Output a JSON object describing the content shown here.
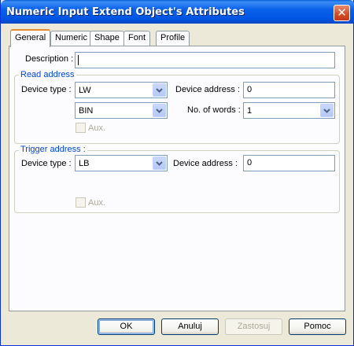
{
  "window": {
    "title": "Numeric Input Extend Object's Attributes"
  },
  "tabs": [
    {
      "label": "General",
      "active": true
    },
    {
      "label": "Numeric",
      "active": false
    },
    {
      "label": "Shape",
      "active": false
    },
    {
      "label": "Font",
      "active": false
    },
    {
      "label": "Profile",
      "active": false
    }
  ],
  "general": {
    "description_label": "Description :",
    "description_value": "",
    "read_address": {
      "title": "Read address",
      "device_type_label": "Device type :",
      "device_type_value": "LW",
      "device_address_label": "Device address :",
      "device_address_value": "0",
      "format_value": "BIN",
      "no_of_words_label": "No. of words :",
      "no_of_words_value": "1",
      "aux_label": "Aux."
    },
    "trigger_address": {
      "title": "Trigger address :",
      "device_type_label": "Device type :",
      "device_type_value": "LB",
      "device_address_label": "Device  address :",
      "device_address_value": "0",
      "aux_label": "Aux."
    }
  },
  "buttons": {
    "ok": "OK",
    "cancel": "Anuluj",
    "apply": "Zastosuj",
    "help": "Pomoc"
  }
}
